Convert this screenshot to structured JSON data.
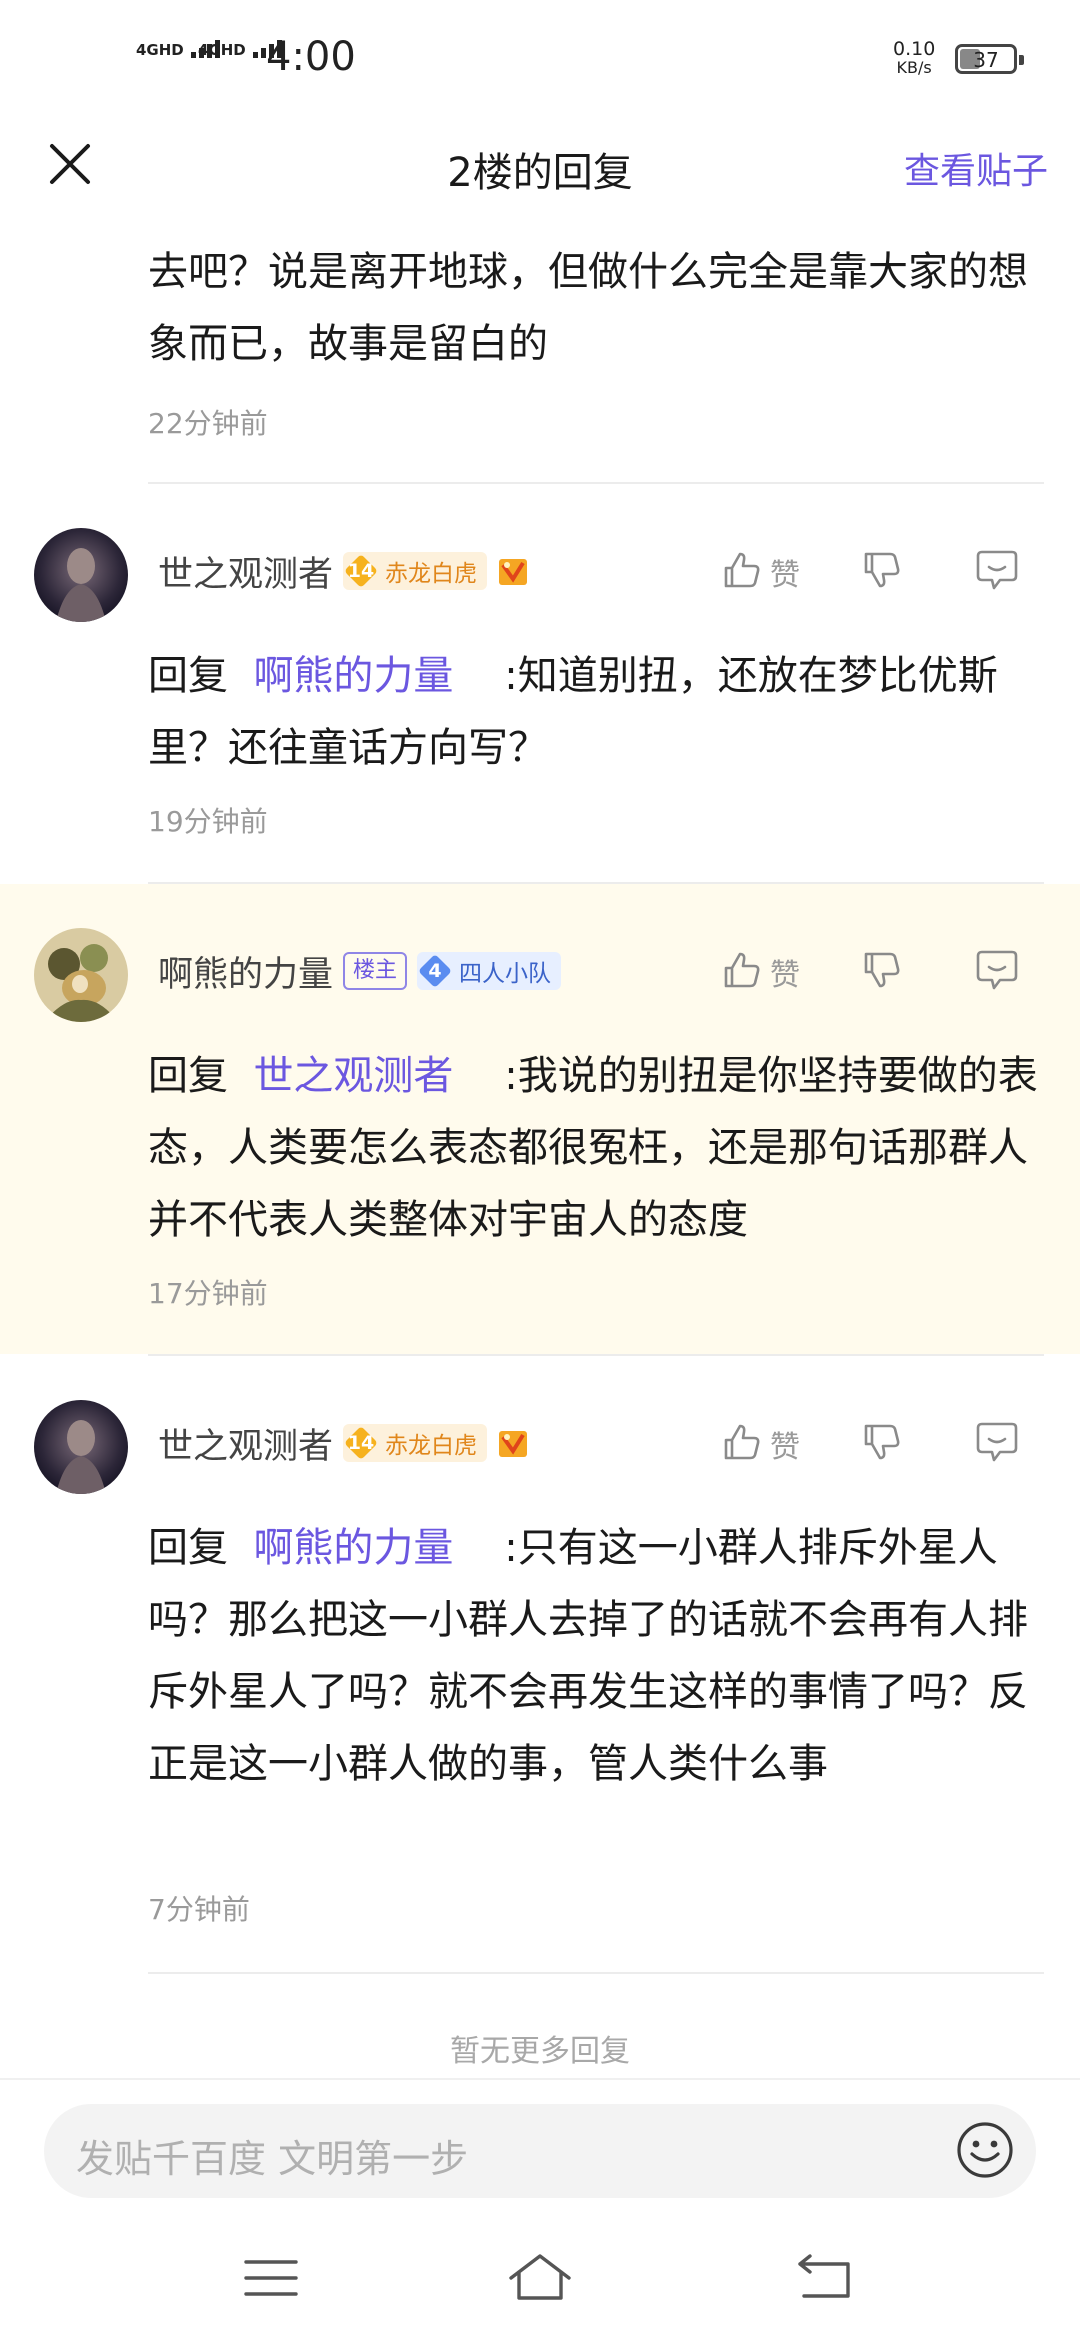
{
  "status_bar": {
    "sim1": "4GHD",
    "sim2": "4GHD",
    "time": "4:00",
    "net_speed_value": "0.10",
    "net_speed_unit": "KB/s",
    "battery": "37"
  },
  "header": {
    "title": "2楼的回复",
    "view_post": "查看贴子",
    "close_icon": "close-icon"
  },
  "first": {
    "text": "去吧？说是离开地球，但做什么完全是靠大家的想象而已，故事是留白的",
    "time": "22分钟前"
  },
  "replies": [
    {
      "username": "世之观测者",
      "level": "14",
      "level_name": "赤龙白虎",
      "level_color": "#f6b21e",
      "level_text_color": "#e0861b",
      "has_medal": true,
      "like_label": "赞",
      "reply_prefix": "回复",
      "mention": "啊熊的力量",
      "text": ":知道别扭，还放在梦比优斯里？还往童话方向写？",
      "time": "19分钟前"
    },
    {
      "username": "啊熊的力量",
      "host_tag": "楼主",
      "level": "4",
      "level_name": "四人小队",
      "level_color": "#5a8cf0",
      "level_text_color": "#3b63c9",
      "like_label": "赞",
      "reply_prefix": "回复",
      "mention": "世之观测者",
      "text": ":我说的别扭是你坚持要做的表态，人类要怎么表态都很冤枉，还是那句话那群人并不代表人类整体对宇宙人的态度",
      "time": "17分钟前"
    },
    {
      "username": "世之观测者",
      "level": "14",
      "level_name": "赤龙白虎",
      "level_color": "#f6b21e",
      "level_text_color": "#e0861b",
      "has_medal": true,
      "like_label": "赞",
      "reply_prefix": "回复",
      "mention": "啊熊的力量",
      "text": ":只有这一小群人排斥外星人吗？那么把这一小群人去掉了的话就不会再有人排斥外星人了吗？就不会再发生这样的事情了吗？反正是这一小群人做的事，管人类什么事",
      "time": "7分钟前"
    }
  ],
  "no_more": "暂无更多回复",
  "comment_bar": {
    "placeholder": "发贴千百度  文明第一步"
  }
}
